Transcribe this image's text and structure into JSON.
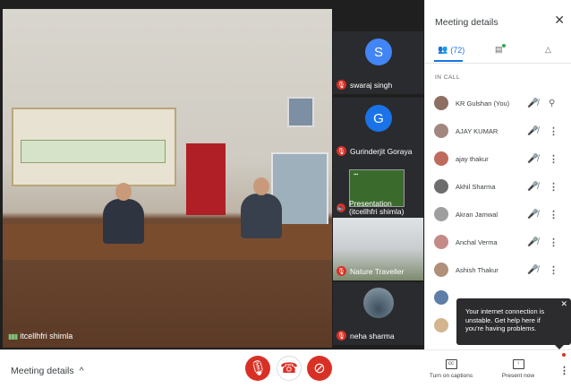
{
  "main": {
    "speaker_name": "itcellhfri shimla",
    "banner_text": "HIMALAYAN FOREST RESEARCH INSTITUTE",
    "welcome_text": "WELCOME"
  },
  "tiles": [
    {
      "name": "swaraj singh",
      "avatar_letter": "S",
      "avatar_color": "#4285f4"
    },
    {
      "name": "Gurinderjit Goraya",
      "avatar_letter": "G",
      "avatar_color": "#1a73e8"
    },
    {
      "name_line1": "Presentation",
      "name_line2": "(itcellhfri shimla)"
    },
    {
      "name": "Nature Traveller"
    },
    {
      "name": "neha sharma"
    }
  ],
  "panel": {
    "title": "Meeting details",
    "people_count": "(72)",
    "in_call_label": "IN CALL",
    "participants": [
      {
        "name": "KR Gulshan (You)",
        "color": "#8d6e63"
      },
      {
        "name": "AJAY KUMAR",
        "color": "#a1887f"
      },
      {
        "name": "ajay thakur",
        "color": "#bf6b5c"
      },
      {
        "name": "Akhil Sharma",
        "color": "#6d6d6d"
      },
      {
        "name": "Akran Jamwal",
        "color": "#9e9e9e"
      },
      {
        "name": "Anchal Verma",
        "color": "#c48b86"
      },
      {
        "name": "Ashish Thakur",
        "color": "#b0907a"
      }
    ]
  },
  "toast": {
    "text": "Your internet connection is unstable. Get help here if you're having problems."
  },
  "bottombar": {
    "meeting_details_label": "Meeting details",
    "captions_label": "Turn on captions",
    "captions_icon_text": "cc",
    "present_label": "Present now"
  },
  "colors": {
    "accent": "#1a73e8",
    "danger": "#d93025"
  }
}
